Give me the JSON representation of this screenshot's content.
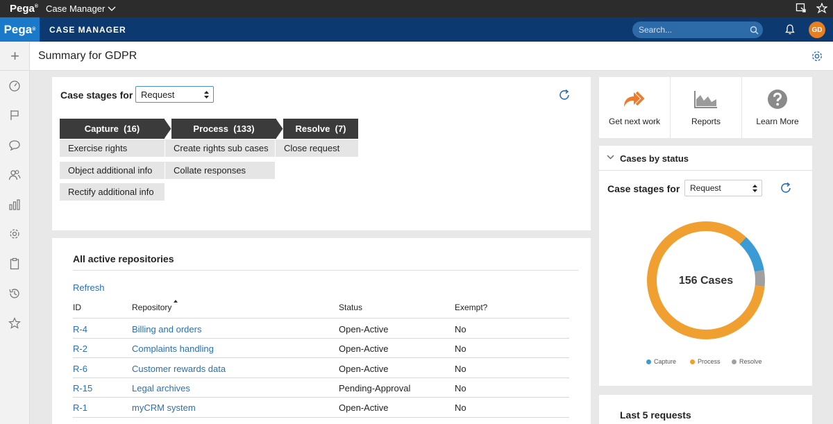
{
  "system_bar": {
    "brand": "Pega",
    "portal_label": "Case Manager"
  },
  "header": {
    "logo": "Pega",
    "app_name": "CASE MANAGER",
    "search_placeholder": "Search...",
    "avatar_initials": "GD"
  },
  "page": {
    "title": "Summary for GDPR"
  },
  "case_stages": {
    "label": "Case stages for",
    "selected": "Request",
    "stages": [
      {
        "name": "Capture",
        "count": "(16)",
        "items": [
          "Exercise rights",
          "Object additional info",
          "Rectify additional info"
        ]
      },
      {
        "name": "Process",
        "count": "(133)",
        "items": [
          "Create rights sub cases",
          "Collate responses"
        ]
      },
      {
        "name": "Resolve",
        "count": "(7)",
        "items": [
          "Close request"
        ]
      }
    ]
  },
  "repositories": {
    "title": "All active repositories",
    "refresh_label": "Refresh",
    "columns": [
      "ID",
      "Repository",
      "Status",
      "Exempt?"
    ],
    "rows": [
      {
        "id": "R-4",
        "name": "Billing and orders",
        "status": "Open-Active",
        "exempt": "No"
      },
      {
        "id": "R-2",
        "name": "Complaints handling",
        "status": "Open-Active",
        "exempt": "No"
      },
      {
        "id": "R-6",
        "name": "Customer rewards data",
        "status": "Open-Active",
        "exempt": "No"
      },
      {
        "id": "R-15",
        "name": "Legal archives",
        "status": "Pending-Approval",
        "exempt": "No"
      },
      {
        "id": "R-1",
        "name": "myCRM system",
        "status": "Open-Active",
        "exempt": "No"
      }
    ]
  },
  "quick_actions": [
    {
      "label": "Get next work",
      "icon": "forward-arrows-icon"
    },
    {
      "label": "Reports",
      "icon": "area-chart-icon"
    },
    {
      "label": "Learn More",
      "icon": "help-circle-icon"
    }
  ],
  "cases_by_status": {
    "title": "Cases by status",
    "label": "Case stages for",
    "selected": "Request",
    "center_label": "156 Cases"
  },
  "chart_data": {
    "type": "pie",
    "categories": [
      "Capture",
      "Process",
      "Resolve"
    ],
    "values": [
      16,
      133,
      7
    ],
    "colors": [
      "#3a9bd5",
      "#f0a030",
      "#a0a0a0"
    ],
    "center_label": "156 Cases",
    "legend_position": "bottom"
  },
  "last_requests": {
    "title": "Last 5 requests"
  },
  "colors": {
    "header_bg": "#0c3a70",
    "logo_bg": "#1a79c8",
    "link": "#2a6fb5",
    "stage_bg": "#3b3b3b",
    "avatar": "#e67e22"
  }
}
